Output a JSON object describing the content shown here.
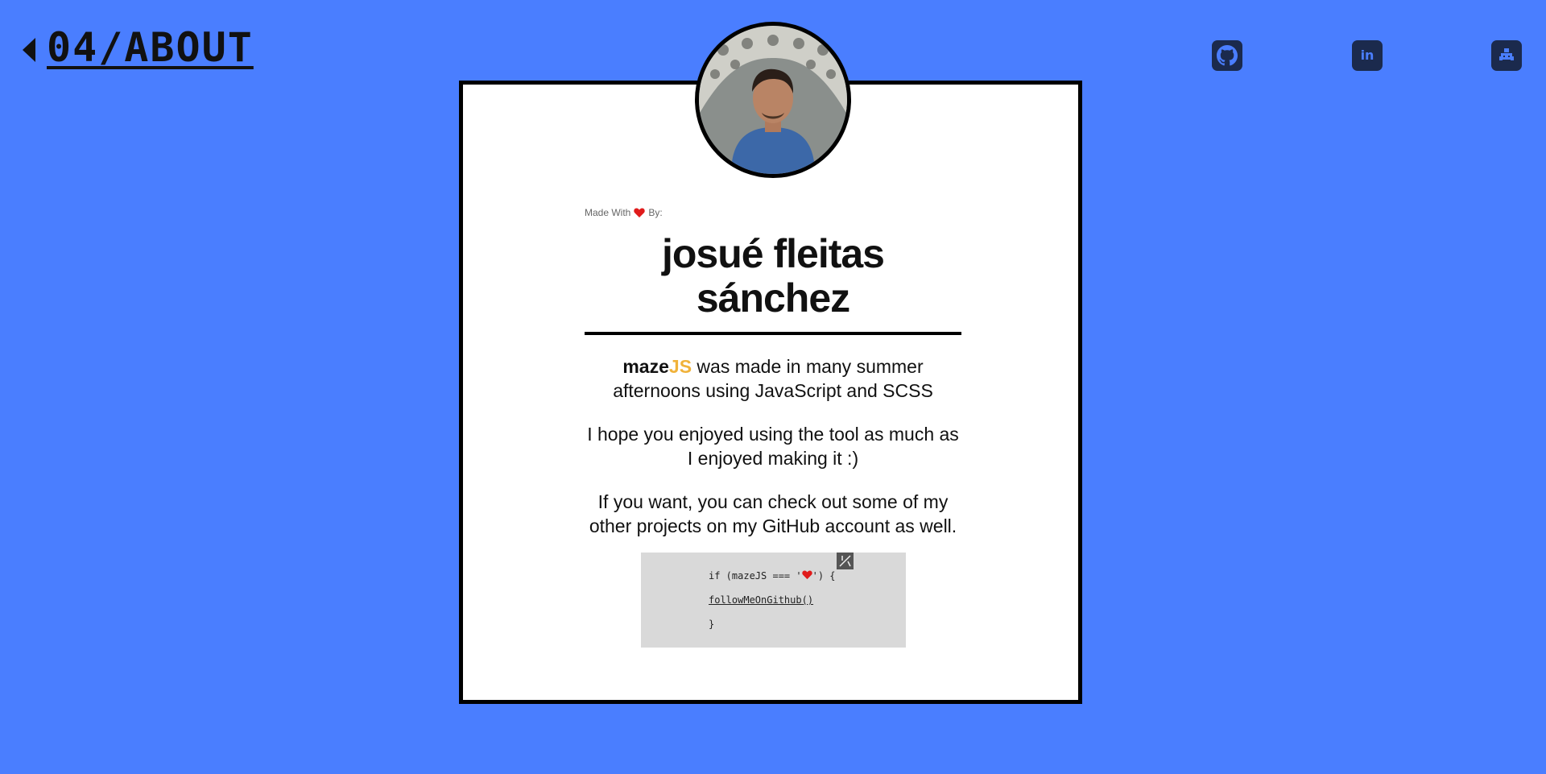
{
  "header": {
    "title": "04/ABOUT"
  },
  "social": {
    "icons": [
      "github-icon",
      "linkedin-icon",
      "extra-icon"
    ],
    "linkedin_text": "in"
  },
  "card": {
    "made_with_prefix": "Made With",
    "made_with_suffix": "By:",
    "name": "josué fleitas sánchez",
    "brand_maze": "maze",
    "brand_js": "JS",
    "para1_rest": " was made in many summer afternoons using JavaScript and SCSS",
    "para2": "I hope you enjoyed using the tool as much as I enjoyed making it :)",
    "para3": "If you want, you can check out some of my other projects on my GitHub account as well."
  },
  "code": {
    "line1_prefix": "if (mazeJS === '",
    "line1_suffix": "') {",
    "line2": "followMeOnGithub()",
    "line3": "}"
  },
  "colors": {
    "background": "#4a7eff",
    "icon_bg": "#1b2a4d",
    "accent_js": "#f0b23a",
    "heart": "#e01b1b"
  }
}
